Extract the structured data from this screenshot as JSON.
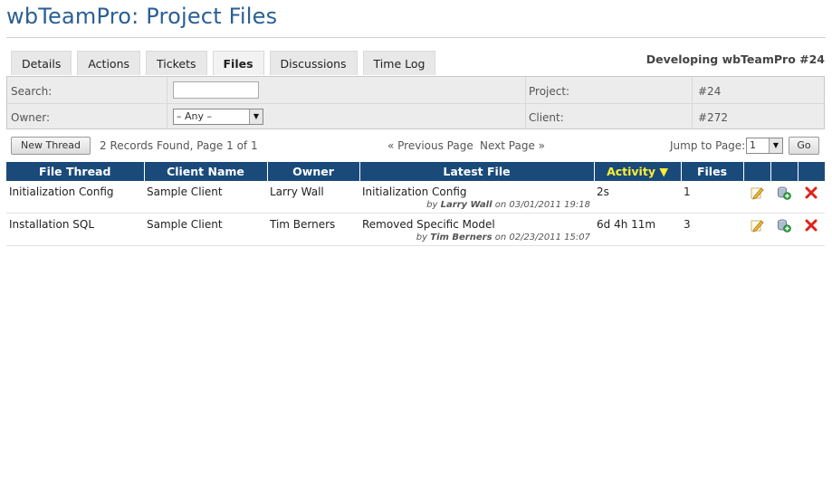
{
  "page": {
    "title": "wbTeamPro: Project Files"
  },
  "tabs": [
    {
      "label": "Details"
    },
    {
      "label": "Actions"
    },
    {
      "label": "Tickets"
    },
    {
      "label": "Files",
      "active": true
    },
    {
      "label": "Discussions"
    },
    {
      "label": "Time Log"
    }
  ],
  "project_heading": "Developing wbTeamPro #24",
  "filters": {
    "search_label": "Search:",
    "search_value": "",
    "owner_label": "Owner:",
    "owner_selected": "– Any –",
    "project_label": "Project:",
    "project_value": "#24",
    "client_label": "Client:",
    "client_value": "#272"
  },
  "toolbar": {
    "new_thread_label": "New Thread",
    "records_text": "2 Records Found, Page 1 of 1",
    "prev_label": "« Previous Page",
    "next_label": "Next Page »",
    "jump_label": "Jump to Page:",
    "jump_value": "1",
    "go_label": "Go"
  },
  "table": {
    "columns": [
      "File Thread",
      "Client Name",
      "Owner",
      "Latest File",
      "Activity ▼",
      "Files",
      "",
      "",
      ""
    ],
    "sorted_column": "Activity",
    "rows": [
      {
        "thread": "Initialization Config",
        "client": "Sample Client",
        "owner": "Larry Wall",
        "latest_file": "Initialization Config",
        "by_prefix": "by",
        "by_user": "Larry Wall",
        "on_text": "on 03/01/2011 19:18",
        "activity": "2s",
        "files": "1",
        "icons": [
          "edit-icon",
          "add-file-icon",
          "delete-icon"
        ]
      },
      {
        "thread": "Installation SQL",
        "client": "Sample Client",
        "owner": "Tim Berners",
        "latest_file": "Removed Specific Model",
        "by_prefix": "by",
        "by_user": "Tim Berners",
        "on_text": "on 02/23/2011 15:07",
        "activity": "6d 4h 11m",
        "files": "3",
        "icons": [
          "edit-icon",
          "add-file-icon",
          "delete-icon"
        ]
      }
    ]
  },
  "colors": {
    "title": "#2b5f94",
    "header_bg": "#1a4a7a",
    "sorted_header": "#ffee33",
    "delete": "#e0201a"
  }
}
